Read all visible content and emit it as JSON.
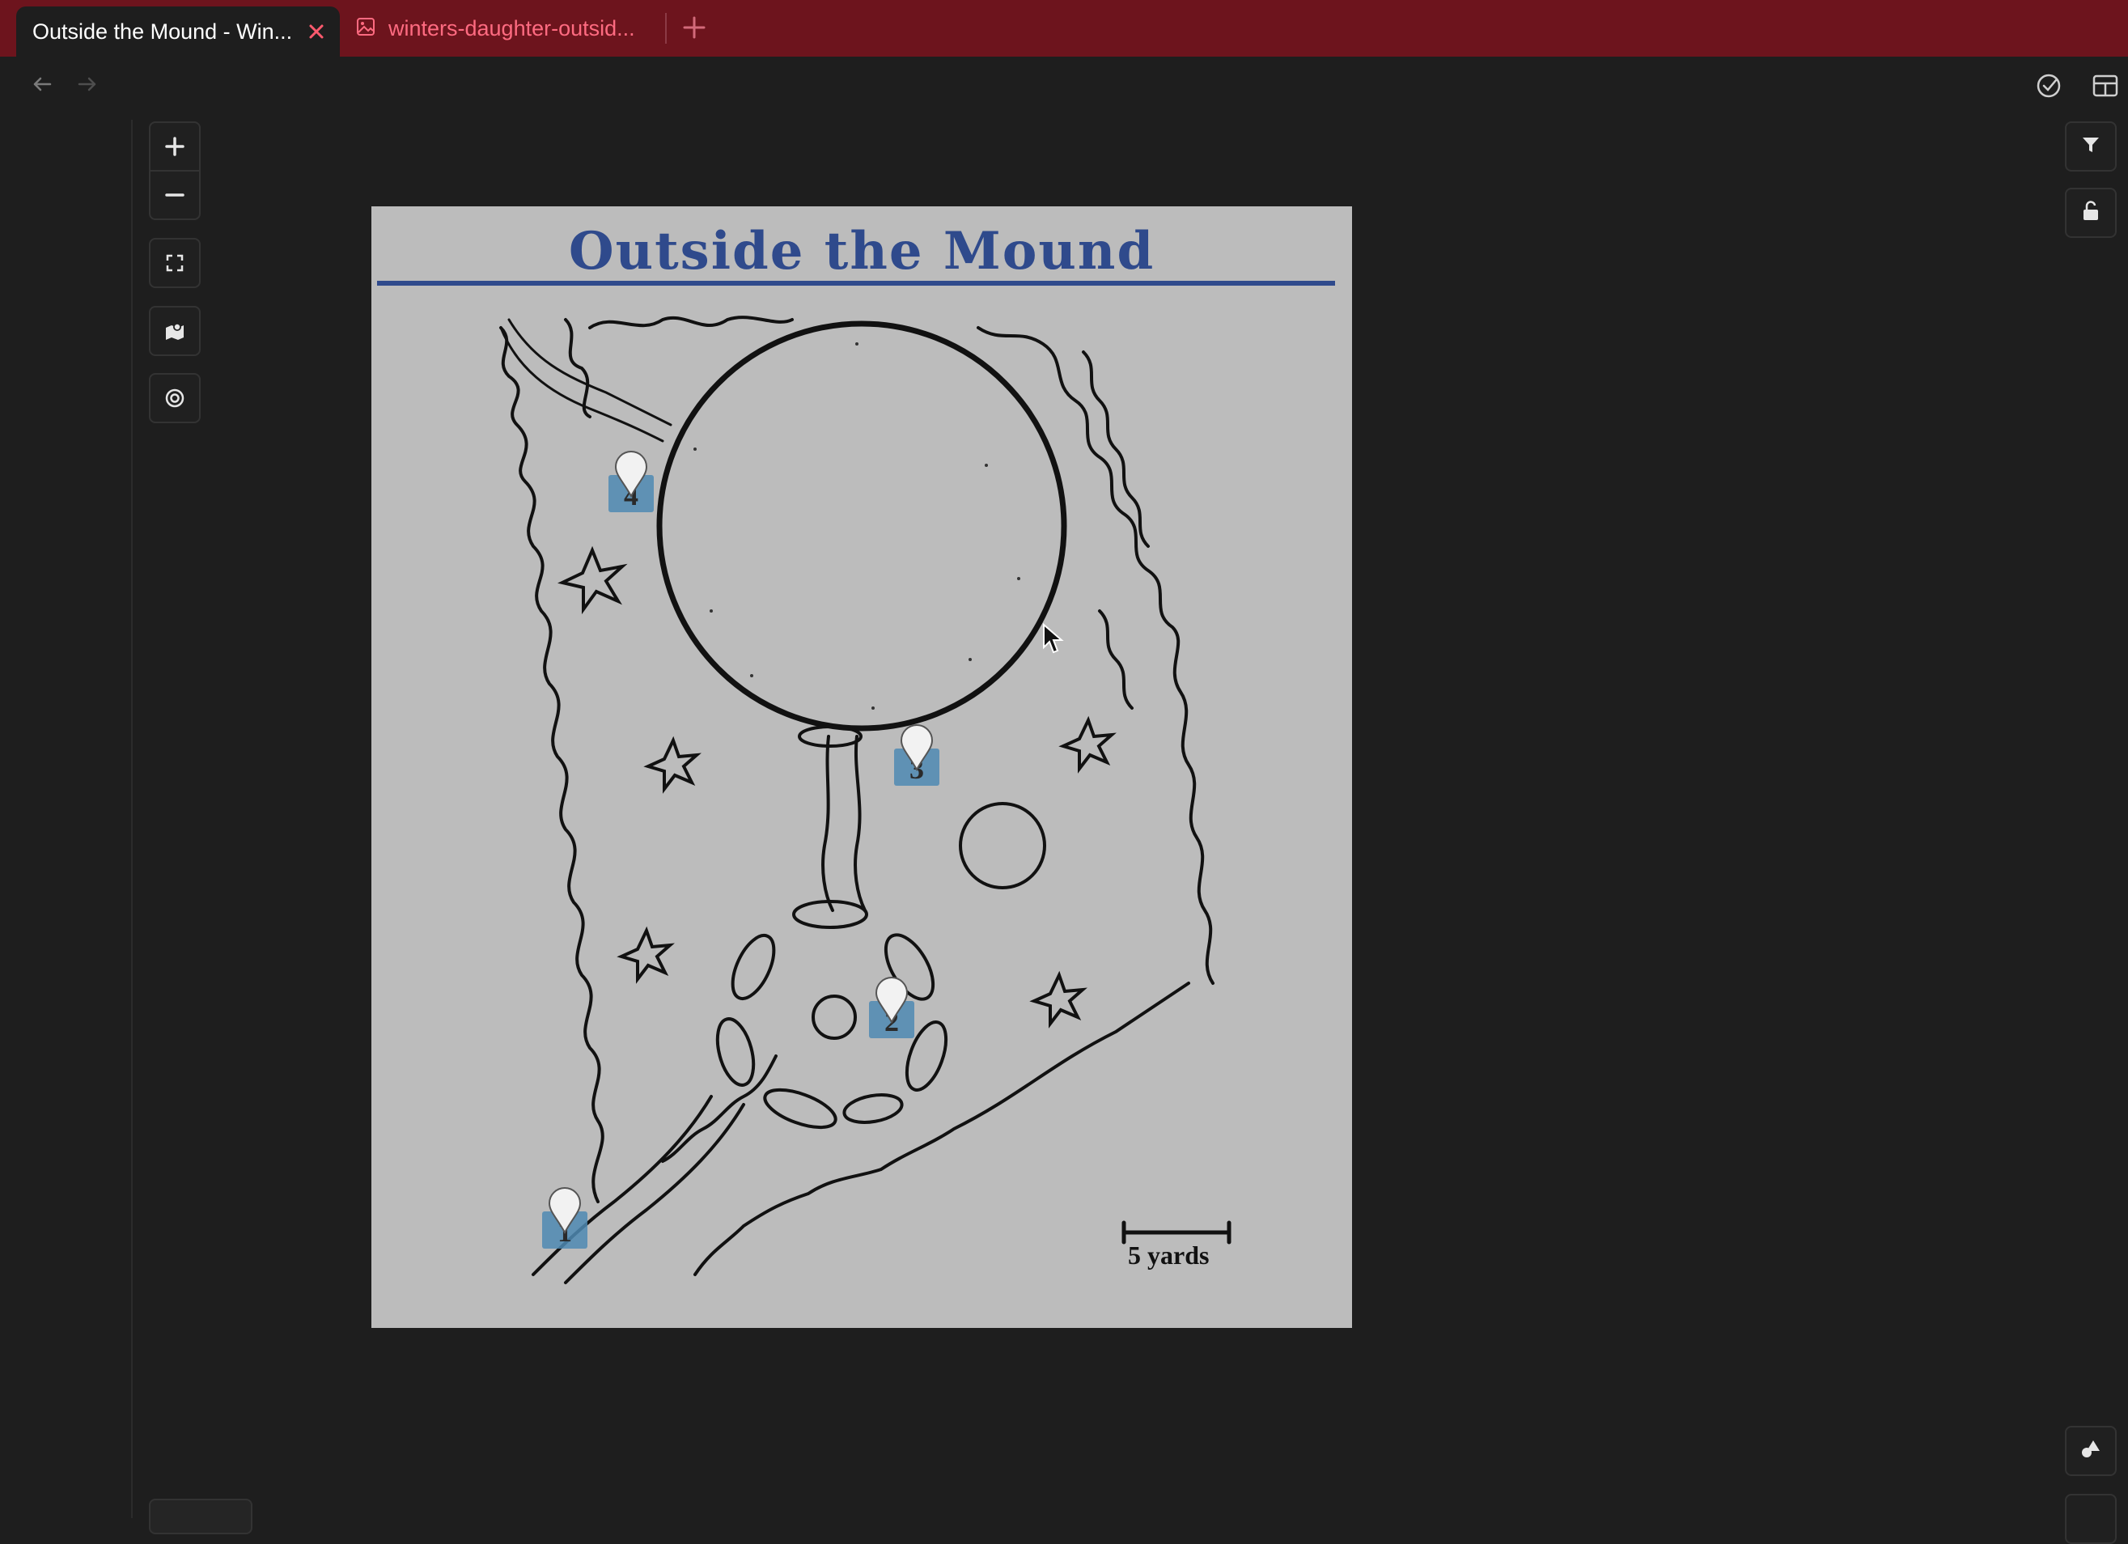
{
  "tabs": [
    {
      "title": "Outside the Mound - Win...",
      "active": true
    },
    {
      "title": "winters-daughter-outsid...",
      "active": false
    }
  ],
  "map": {
    "title": "Outside the Mound",
    "scale_label": "5 yards",
    "markers": [
      "1",
      "2",
      "3",
      "4"
    ]
  },
  "colors": {
    "tabbar": "#6d141d",
    "inactive_tab_text": "#ff6b81",
    "map_title": "#2f4a8c",
    "marker_badge": "#4f8ab3"
  },
  "icons": {
    "new_tab": "plus-icon",
    "back": "arrow-left-icon",
    "forward": "arrow-right-icon",
    "zoom_in": "plus-icon",
    "zoom_out": "minus-icon",
    "fullscreen": "expand-icon",
    "map_layers": "map-pin-icon",
    "target": "target-icon",
    "filter": "filter-icon",
    "lock": "unlock-icon",
    "shapes": "shapes-icon"
  }
}
